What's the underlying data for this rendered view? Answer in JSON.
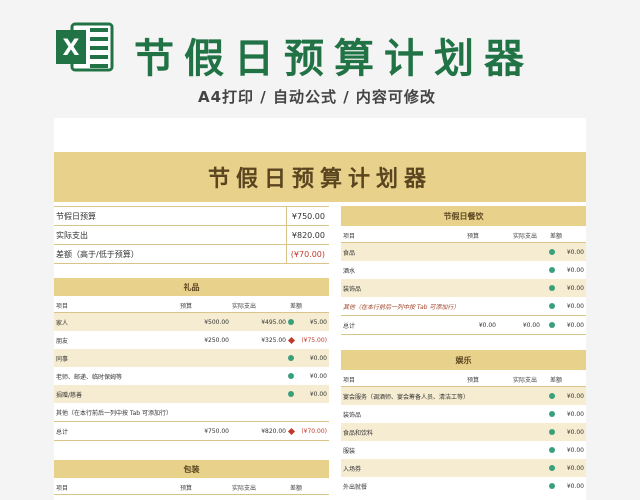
{
  "header": {
    "title": "节假日预算计划器",
    "subtitle": "A4打印 / 自动公式 / 内容可修改",
    "logo_letter": "X"
  },
  "doc": {
    "banner_title": "节假日预算计划器",
    "summary": [
      {
        "label": "节假日预算",
        "value": "¥750.00"
      },
      {
        "label": "实际支出",
        "value": "¥820.00"
      },
      {
        "label": "差额（高于/低于预算）",
        "value": "(¥70.00)"
      }
    ],
    "gifts": {
      "title": "礼品",
      "cols": [
        "项目",
        "预算",
        "实际支出",
        "差额"
      ],
      "rows": [
        {
          "item": "家人",
          "budget": "¥500.00",
          "actual": "¥495.00",
          "diff": "¥5.00",
          "status": "ok"
        },
        {
          "item": "朋友",
          "budget": "¥250.00",
          "actual": "¥325.00",
          "diff": "(¥75.00)",
          "status": "over"
        },
        {
          "item": "同事",
          "budget": "",
          "actual": "",
          "diff": "¥0.00",
          "status": "ok"
        },
        {
          "item": "老师、邮递、临时保姆等",
          "budget": "",
          "actual": "",
          "diff": "¥0.00",
          "status": "ok"
        },
        {
          "item": "捐赠/慈善",
          "budget": "",
          "actual": "",
          "diff": "¥0.00",
          "status": "ok"
        },
        {
          "item": "其他（在本行前后一列中按 Tab 可添加行）",
          "budget": "",
          "actual": "",
          "diff": "",
          "status": ""
        }
      ],
      "total": {
        "label": "总计",
        "budget": "¥750.00",
        "actual": "¥820.00",
        "diff": "(¥70.00)"
      }
    },
    "packaging": {
      "title": "包装",
      "cols": [
        "项目",
        "预算",
        "实际支出",
        "差额"
      ]
    },
    "dinner": {
      "title": "节假日餐饮",
      "cols": [
        "项目",
        "预算",
        "实际支出",
        "差额"
      ],
      "rows": [
        {
          "item": "食品",
          "diff": "¥0.00"
        },
        {
          "item": "酒水",
          "diff": "¥0.00"
        },
        {
          "item": "装饰品",
          "diff": "¥0.00"
        },
        {
          "item": "其他（在本行前后一列中按 Tab 可添加行）",
          "diff": "¥0.00"
        }
      ],
      "total": {
        "label": "总计",
        "budget": "¥0.00",
        "actual": "¥0.00",
        "diff": "¥0.00"
      }
    },
    "entertainment": {
      "title": "娱乐",
      "cols": [
        "项目",
        "预算",
        "实际支出",
        "差额"
      ],
      "rows": [
        {
          "item": "宴会服务（调酒师、宴会筹备人员、清洁工等）",
          "diff": "¥0.00"
        },
        {
          "item": "装饰品",
          "diff": "¥0.00"
        },
        {
          "item": "食品和饮料",
          "diff": "¥0.00"
        },
        {
          "item": "服装",
          "diff": "¥0.00"
        },
        {
          "item": "入场券",
          "diff": "¥0.00"
        },
        {
          "item": "外出就餐",
          "diff": "¥0.00"
        }
      ]
    }
  },
  "colors": {
    "brand": "#217346",
    "gold": "#e8d18b",
    "ok": "#3aa07a",
    "over": "#c0392b"
  }
}
